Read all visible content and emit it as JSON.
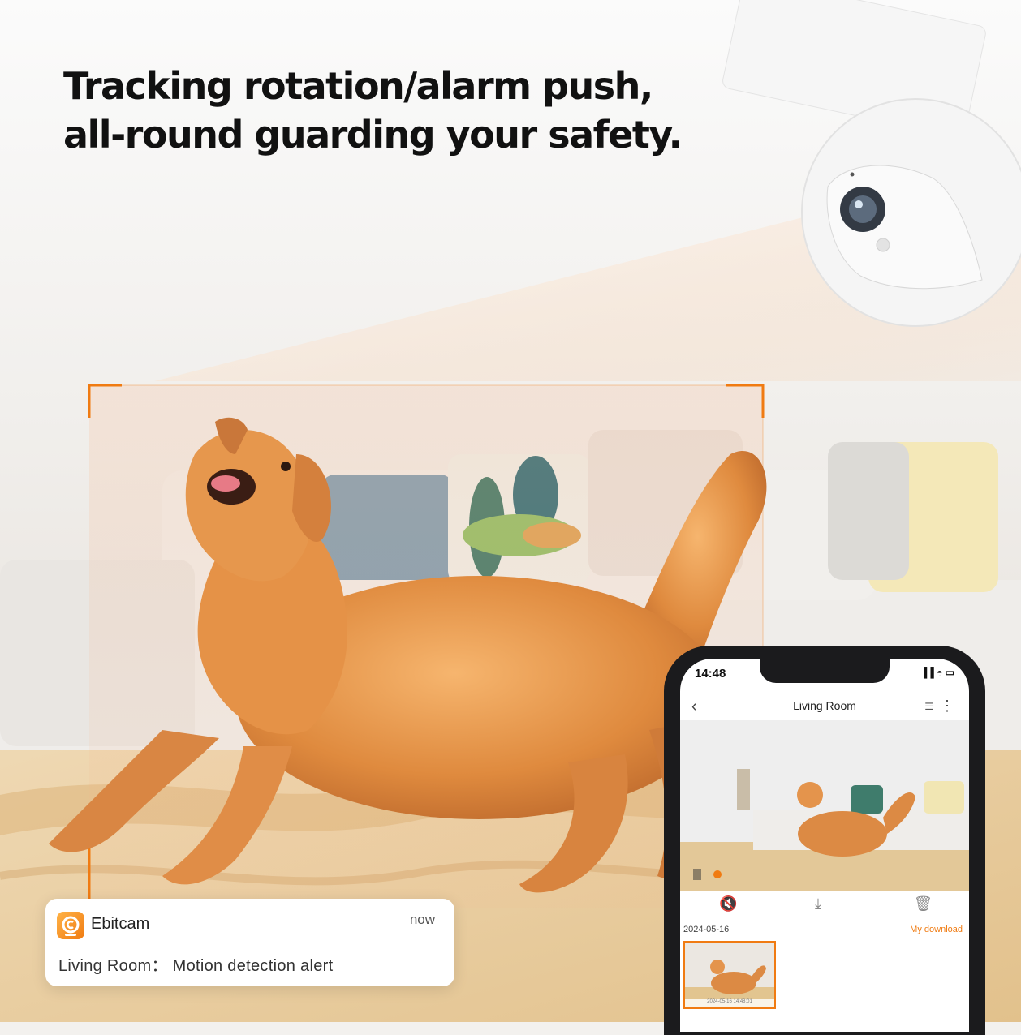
{
  "headline": {
    "line1": "Tracking rotation/alarm push,",
    "line2": "all-round guarding your safety."
  },
  "notification": {
    "app_name": "Ebitcam",
    "time": "now",
    "message": "Living Room： Motion detection alert",
    "app_icon": "ebitcam-logo-icon"
  },
  "phone": {
    "status_time": "14:48",
    "status_icons": "▐▐ ◓ ▭",
    "title": "Living Room",
    "date_label": "2024-05-16",
    "download_link": "My download",
    "thumb_timestamp": "2024-05-16 14:48:01",
    "icons": [
      "back-icon",
      "equalizer-icon",
      "more-icon",
      "mute-icon",
      "download-icon",
      "delete-icon"
    ]
  },
  "colors": {
    "accent": "#f07b12",
    "tracking_frame": "#f07b12",
    "headline_text": "#111111"
  }
}
